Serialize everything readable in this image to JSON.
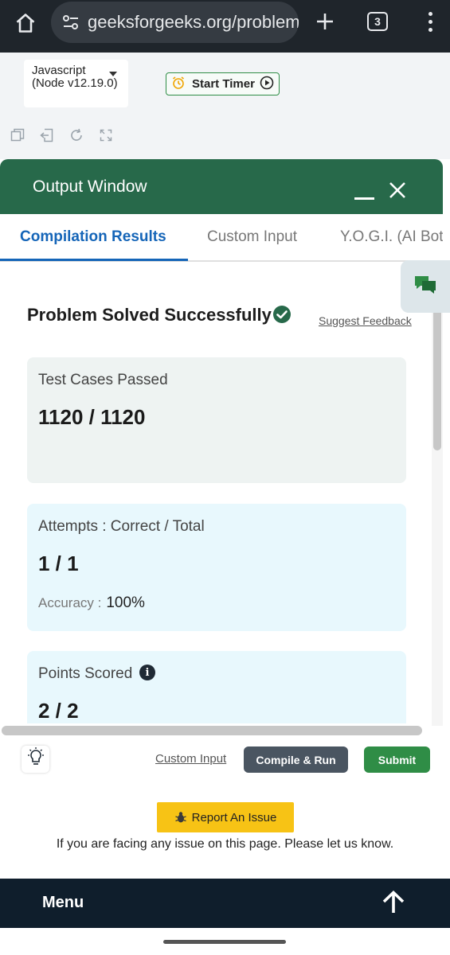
{
  "browser": {
    "url": "geeksforgeeks.org/problem",
    "tab_count": "3"
  },
  "editor": {
    "language": "Javascript (Node v12.19.0)",
    "timer_label": "Start Timer"
  },
  "output_window": {
    "title": "Output Window",
    "tabs": [
      "Compilation Results",
      "Custom Input",
      "Y.O.G.I. (AI Bot)"
    ],
    "active_tab": "Compilation Results",
    "status": "Problem Solved Successfully",
    "suggest_feedback": "Suggest Feedback",
    "cards": {
      "test_cases": {
        "label": "Test Cases Passed",
        "value": "1120 / 1120"
      },
      "attempts": {
        "label": "Attempts : Correct / Total",
        "value": "1 / 1",
        "accuracy_label": "Accuracy :",
        "accuracy_value": "100%"
      },
      "points": {
        "label": "Points Scored",
        "value": "2 / 2"
      }
    }
  },
  "actions": {
    "custom_input": "Custom Input",
    "compile_run": "Compile & Run",
    "submit": "Submit"
  },
  "report": {
    "button": "Report An Issue",
    "text": "If you are facing any issue on this page. Please let us know."
  },
  "footer": {
    "menu": "Menu"
  },
  "colors": {
    "header_green": "#27694a",
    "tab_blue": "#1565b8",
    "submit_green": "#2f8d46",
    "report_yellow": "#f7c315",
    "footer_navy": "#0f1e2c"
  }
}
